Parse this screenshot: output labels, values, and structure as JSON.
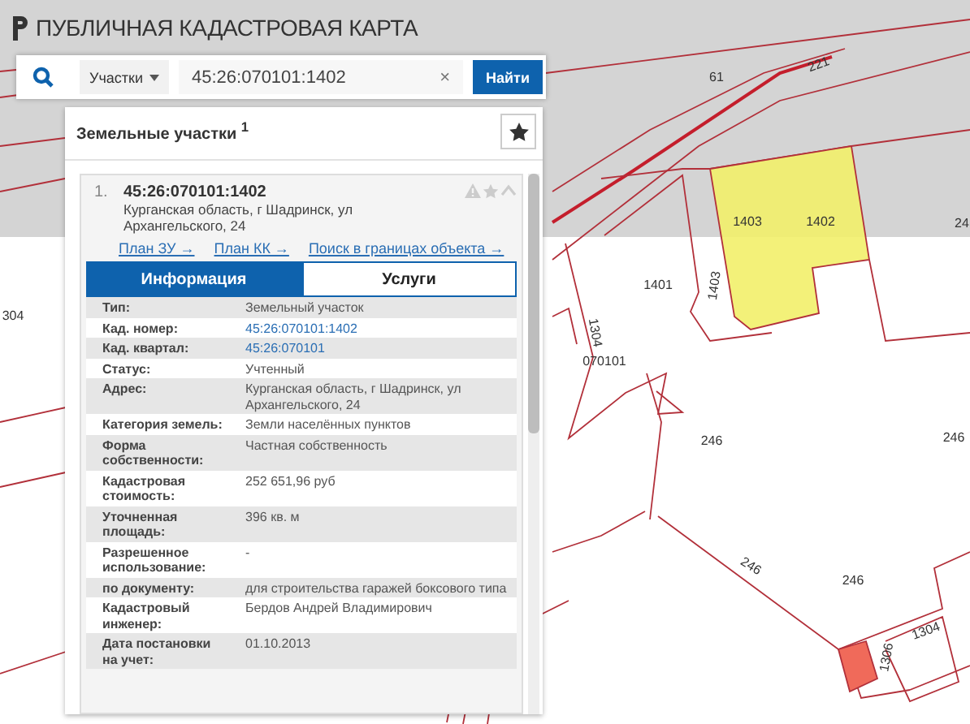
{
  "header": {
    "title": "ПУБЛИЧНАЯ КАДАСТРОВАЯ КАРТА"
  },
  "search": {
    "category": "Участки",
    "value": "45:26:070101:1402",
    "clear": "×",
    "button": "Найти"
  },
  "results": {
    "title": "Земельные участки $^{1}$",
    "items": [
      {
        "number": "1.",
        "cadastral_number": "45:26:070101:1402",
        "address": "Курганская область, г Шадринск, ул Архангельского, 24",
        "expanded": true,
        "links": [
          "План ЗУ →",
          "План КК →",
          "Поиск в границах объекта →"
        ],
        "tabs": [
          {
            "label": "Информация",
            "selected": true
          },
          {
            "label": "Услуги",
            "selected": false
          }
        ],
        "fields": [
          {
            "label": "Тип:",
            "value": "Земельный участок",
            "kind": "text"
          },
          {
            "label": "Кад. номер:",
            "value": "45:26:070101:1402",
            "kind": "link"
          },
          {
            "label": "Кад. квартал:",
            "value": "45:26:070101",
            "kind": "link"
          },
          {
            "label": "Статус:",
            "value": "Учтенный",
            "kind": "text"
          },
          {
            "label": "Адрес:",
            "value": "Курганская область, г Шадринск, ул Архангельского, 24",
            "kind": "text"
          },
          {
            "label": "Категория земель:",
            "value": "Земли населённых пунктов",
            "kind": "text"
          },
          {
            "label": "Форма собственности:",
            "value": "Частная собственность",
            "kind": "text"
          },
          {
            "label": "Кадастровая стоимость:",
            "value": "252 651,96 руб",
            "kind": "text"
          },
          {
            "label": "Уточненная площадь:",
            "value": "396 кв. м",
            "kind": "text"
          },
          {
            "label": "Разрешенное использование:",
            "value": "-",
            "kind": "text"
          },
          {
            "label": "по документу:",
            "value": "для строительства гаражей боксового типа",
            "kind": "text"
          },
          {
            "label": "Кадастровый инженер:",
            "value": "Бердов Андрей Владимирович",
            "kind": "text"
          },
          {
            "label": "Дата постановки на учет:",
            "value": "01.10.2013",
            "kind": "text"
          }
        ]
      }
    ]
  },
  "map": {
    "labels": [
      "61",
      "221",
      "1403",
      "1402",
      "1401",
      "1403",
      "1304",
      "070101",
      "304",
      "246",
      "246",
      "246",
      "246",
      "1306",
      "1304",
      "24"
    ]
  }
}
